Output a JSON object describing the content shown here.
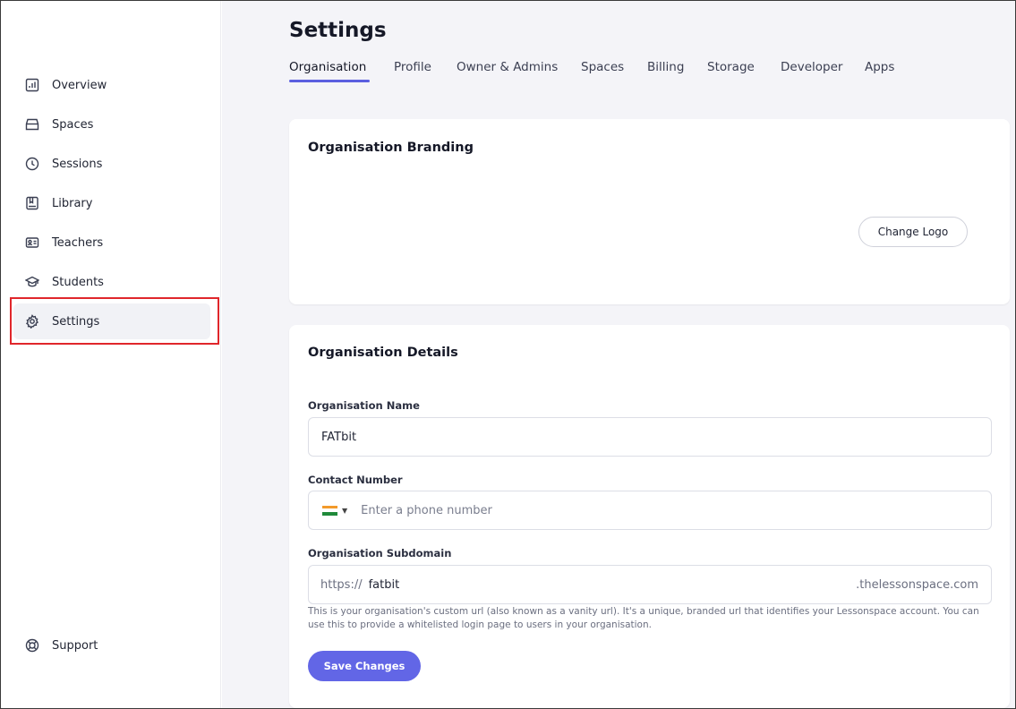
{
  "sidebar": {
    "items": [
      {
        "label": "Overview",
        "icon": "bar-chart-icon"
      },
      {
        "label": "Spaces",
        "icon": "box-icon"
      },
      {
        "label": "Sessions",
        "icon": "clock-icon"
      },
      {
        "label": "Library",
        "icon": "book-icon"
      },
      {
        "label": "Teachers",
        "icon": "id-card-icon"
      },
      {
        "label": "Students",
        "icon": "graduation-cap-icon"
      },
      {
        "label": "Settings",
        "icon": "gear-icon"
      }
    ],
    "support": {
      "label": "Support",
      "icon": "lifebuoy-icon"
    },
    "active": "Settings"
  },
  "header": {
    "title": "Settings",
    "tabs": [
      "Organisation",
      "Profile",
      "Owner & Admins",
      "Spaces",
      "Billing",
      "Storage",
      "Developer",
      "Apps"
    ],
    "active_tab": "Organisation"
  },
  "branding": {
    "title": "Organisation Branding",
    "change_logo": "Change Logo"
  },
  "details": {
    "title": "Organisation Details",
    "name_label": "Organisation Name",
    "name_value": "FATbit",
    "contact_label": "Contact Number",
    "contact_placeholder": "Enter a phone number",
    "subdomain_label": "Organisation Subdomain",
    "subdomain_prefix": "https://",
    "subdomain_value": "fatbit",
    "subdomain_suffix": ".thelessonspace.com",
    "help_text": "This is your organisation's custom url (also known as a vanity url). It's a unique, branded url that identifies your Lessonspace account. You can use this to provide a whitelisted login page to users in your organisation.",
    "save_label": "Save Changes"
  },
  "colors": {
    "accent": "#6266e6",
    "highlight": "#e0262b",
    "background": "#f4f4f8"
  }
}
